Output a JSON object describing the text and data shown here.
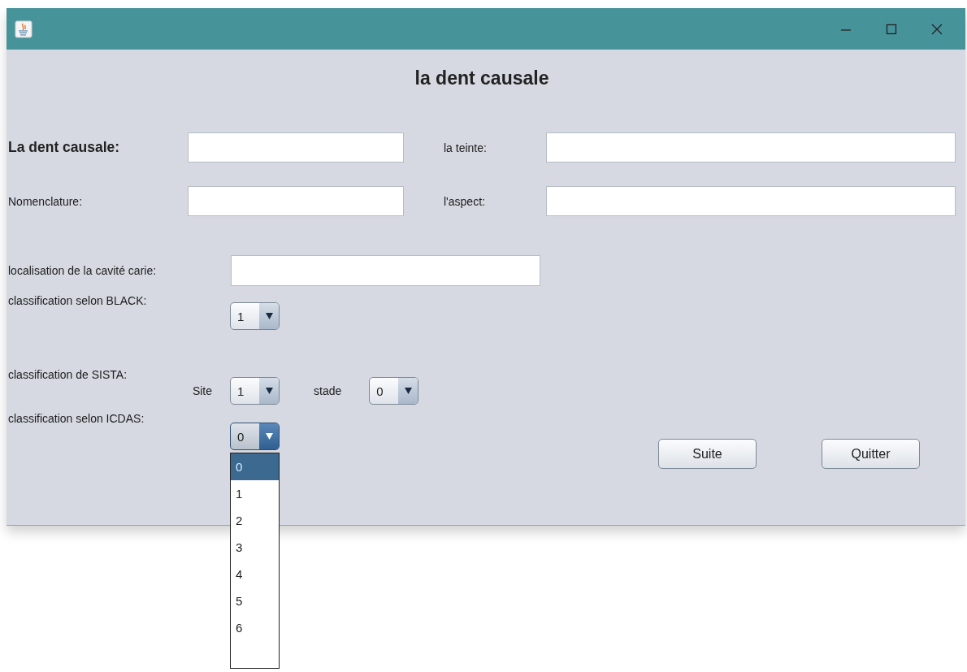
{
  "window": {
    "heading": "la dent causale"
  },
  "top_fields": [
    {
      "label": "La dent causale:",
      "emphasized": true
    },
    {
      "label": "la teinte:",
      "emphasized": false
    },
    {
      "label": "Nomenclature:",
      "emphasized": false
    },
    {
      "label": "l'aspect:",
      "emphasized": false
    }
  ],
  "location": {
    "label": "localisation de la cavité carie:"
  },
  "black": {
    "label": "classification selon BLACK:",
    "combo": {
      "value": "1",
      "expanded": false
    }
  },
  "sista": {
    "label": "classification de SISTA:",
    "site_label": "Site",
    "site": {
      "value": "1",
      "expanded": false
    },
    "stade_label": "stade",
    "stade": {
      "value": "0",
      "expanded": false
    }
  },
  "icdas": {
    "label": "classification selon ICDAS:",
    "combo": {
      "value": "0",
      "expanded": true,
      "options": [
        {
          "label": "0",
          "selected": true
        },
        {
          "label": "1",
          "selected": false
        },
        {
          "label": "2",
          "selected": false
        },
        {
          "label": "3",
          "selected": false
        },
        {
          "label": "4",
          "selected": false
        },
        {
          "label": "5",
          "selected": false
        },
        {
          "label": "6",
          "selected": false
        }
      ]
    }
  },
  "buttons": [
    "Suite",
    "Quitter"
  ]
}
